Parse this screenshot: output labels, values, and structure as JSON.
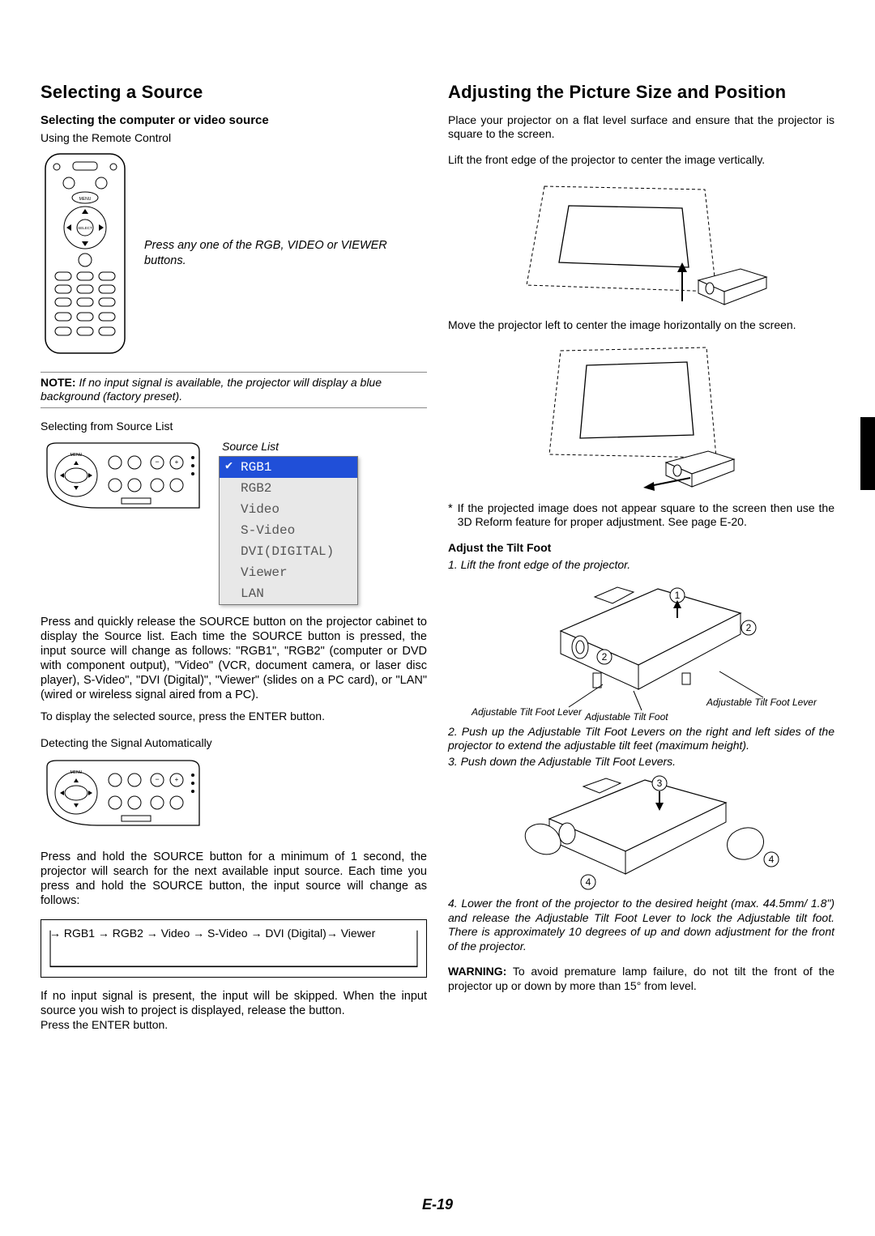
{
  "page_number": "E-19",
  "left": {
    "h1": "Selecting a Source",
    "sub1": "Selecting the computer or video source",
    "using_remote": "Using the Remote Control",
    "remote_caption": "Press any one of the RGB, VIDEO or VIEWER buttons.",
    "note_label": "NOTE:",
    "note_text": " If no input signal is available, the projector will display a blue background (factory preset).",
    "selecting_list": "Selecting from Source List",
    "source_list_label": "Source List",
    "source_items": [
      "RGB1",
      "RGB2",
      "Video",
      "S-Video",
      "DVI(DIGITAL)",
      "Viewer",
      "LAN"
    ],
    "para_sourcebtn": "Press and quickly release the SOURCE button on the projector cabinet to display the Source list. Each time the SOURCE button is pressed, the input source will change as follows: \"RGB1\", \"RGB2\" (computer or DVD with component output), \"Video\" (VCR, document camera, or laser disc player), S-Video\", \"DVI (Digital)\", \"Viewer\" (slides on a PC card), or \"LAN\" (wired or wireless signal aired from a PC).",
    "para_sourcebtn2": "To display the selected source, press the ENTER button.",
    "detecting": "Detecting the Signal Automatically",
    "para_hold": "Press and hold the SOURCE button for a minimum of 1 second, the projector will search for the next available input source. Each time you press and hold the SOURCE button, the input source will change as follows:",
    "cycle": "→ RGB1 → RGB2 → Video → S-Video → DVI (Digital)→ Viewer",
    "para_skip": "If no input signal is present, the input will be skipped. When the input source you wish to project is displayed, release the button.",
    "para_enter": "Press the ENTER button."
  },
  "right": {
    "h1": "Adjusting the Picture Size and Position",
    "p1": "Place your projector on a flat level surface and ensure that the projector is square to the screen.",
    "p2": "Lift the front edge of the projector to center the image vertically.",
    "p3": "Move the projector left to center the image horizontally on the screen.",
    "p4": "If the projected image does not appear square to the screen then use the 3D Reform feature for proper adjustment. See page E-20.",
    "adjust_tilt_h": "Adjust the Tilt Foot",
    "step1": "1. Lift the front edge of the projector.",
    "tilt_label_lever": "Adjustable Tilt Foot Lever",
    "tilt_label_foot": "Adjustable Tilt Foot",
    "step2": "2. Push up the Adjustable Tilt Foot Levers on the right and left sides of the projector to extend the adjustable tilt feet (maximum height).",
    "step3": "3. Push down the Adjustable Tilt Foot Levers.",
    "step4": "4. Lower the front of the projector to the desired height (max. 44.5mm/ 1.8\") and release the Adjustable Tilt Foot Lever to lock the Adjustable tilt foot. There is approximately 10 degrees of up and down adjustment for the front of the projector.",
    "warn_label": "WARNING:",
    "warn_text": " To avoid premature lamp failure, do not tilt the front of the projector up or down by more than 15° from level."
  }
}
